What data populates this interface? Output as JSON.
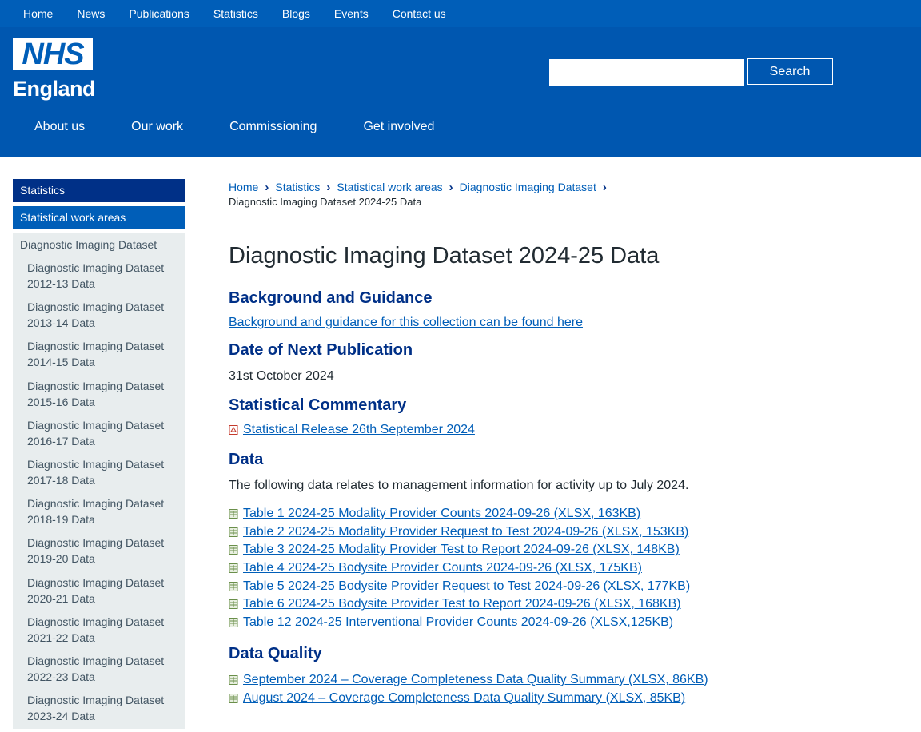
{
  "topnav": [
    "Home",
    "News",
    "Publications",
    "Statistics",
    "Blogs",
    "Events",
    "Contact us"
  ],
  "logo": {
    "mark": "NHS",
    "wordmark": "England"
  },
  "search": {
    "placeholder": "",
    "button": "Search"
  },
  "mainnav": [
    "About us",
    "Our work",
    "Commissioning",
    "Get involved"
  ],
  "sidebar": {
    "heading": "Statistics",
    "section": "Statistical work areas",
    "current": "Diagnostic Imaging Dataset",
    "items": [
      [
        "Diagnostic Imaging Dataset",
        "2012-13 Data"
      ],
      [
        "Diagnostic Imaging Dataset",
        "2013-14 Data"
      ],
      [
        "Diagnostic Imaging Dataset",
        "2014-15 Data"
      ],
      [
        "Diagnostic Imaging Dataset",
        "2015-16 Data"
      ],
      [
        "Diagnostic Imaging Dataset",
        "2016-17 Data"
      ],
      [
        "Diagnostic Imaging Dataset",
        "2017-18 Data"
      ],
      [
        "Diagnostic Imaging Dataset",
        "2018-19 Data"
      ],
      [
        "Diagnostic Imaging Dataset",
        "2019-20 Data"
      ],
      [
        "Diagnostic Imaging Dataset",
        "2020-21 Data"
      ],
      [
        "Diagnostic Imaging Dataset",
        "2021-22 Data"
      ],
      [
        "Diagnostic Imaging Dataset",
        "2022-23 Data"
      ],
      [
        "Diagnostic Imaging Dataset",
        "2023-24 Data"
      ]
    ]
  },
  "breadcrumb": {
    "links": [
      "Home",
      "Statistics",
      "Statistical work areas",
      "Diagnostic Imaging Dataset"
    ],
    "current": "Diagnostic Imaging Dataset 2024-25 Data"
  },
  "page": {
    "title": "Diagnostic Imaging Dataset 2024-25 Data",
    "background_heading": "Background and Guidance",
    "background_link": "Background and guidance for this collection can be found here",
    "next_pub_heading": "Date of Next Publication",
    "next_pub_date": "31st October 2024",
    "commentary_heading": "Statistical Commentary",
    "commentary_link": "Statistical Release 26th September 2024",
    "data_heading": "Data",
    "data_intro": "The following data relates to management information for activity up to July 2024.",
    "data_files": [
      "Table 1 2024-25 Modality Provider Counts 2024-09-26 (XLSX, 163KB)",
      "Table 2 2024-25 Modality Provider Request to Test 2024-09-26 (XLSX, 153KB)",
      "Table 3 2024-25 Modality Provider Test to Report 2024-09-26 (XLSX, 148KB)",
      "Table 4 2024-25 Bodysite Provider Counts 2024-09-26 (XLSX, 175KB)",
      "Table 5 2024-25 Bodysite Provider Request to Test 2024-09-26 (XLSX, 177KB)",
      "Table 6 2024-25 Bodysite Provider Test to Report 2024-09-26 (XLSX, 168KB)",
      "Table 12 2024-25 Interventional Provider Counts 2024-09-26 (XLSX,125KB)"
    ],
    "quality_heading": "Data Quality",
    "quality_files": [
      "September 2024 – Coverage Completeness Data Quality Summary (XLSX, 86KB)",
      "August 2024 – Coverage Completeness Data Quality Summary (XLSX, 85KB)"
    ]
  },
  "colors": {
    "nhs_blue": "#005eb8",
    "dark_blue": "#003087",
    "sidebar_bg": "#e8edee"
  }
}
